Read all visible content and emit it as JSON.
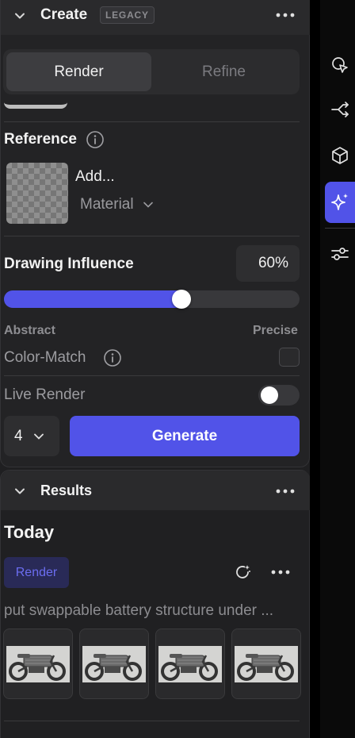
{
  "create": {
    "title": "Create",
    "badge": "LEGACY",
    "tabs": [
      {
        "label": "Render",
        "active": true
      },
      {
        "label": "Refine",
        "active": false
      }
    ],
    "reference": {
      "label": "Reference",
      "add_label": "Add...",
      "type_select": "Material"
    },
    "drawing_influence": {
      "label": "Drawing Influence",
      "value_text": "60%",
      "value": 0.6,
      "min_label": "Abstract",
      "max_label": "Precise"
    },
    "color_match": {
      "label": "Color-Match",
      "checked": false
    },
    "live_render": {
      "label": "Live Render",
      "on": false
    },
    "count": "4",
    "generate_label": "Generate"
  },
  "results": {
    "title": "Results",
    "group_label": "Today",
    "badge": "Render",
    "prompt": "put swappable battery structure under ...",
    "thumbnails": [
      "motorcycle render 1",
      "motorcycle render 2",
      "motorcycle render 3",
      "motorcycle render 4"
    ]
  },
  "toolbar": {
    "icons": [
      "cursor-sparkle-icon",
      "branch-icon",
      "cube-icon",
      "sparkle-icon",
      "sliders-icon"
    ],
    "active": "sparkle-icon"
  },
  "colors": {
    "accent": "#5153e8",
    "panel": "#232325",
    "badge_bg": "#292a57"
  }
}
